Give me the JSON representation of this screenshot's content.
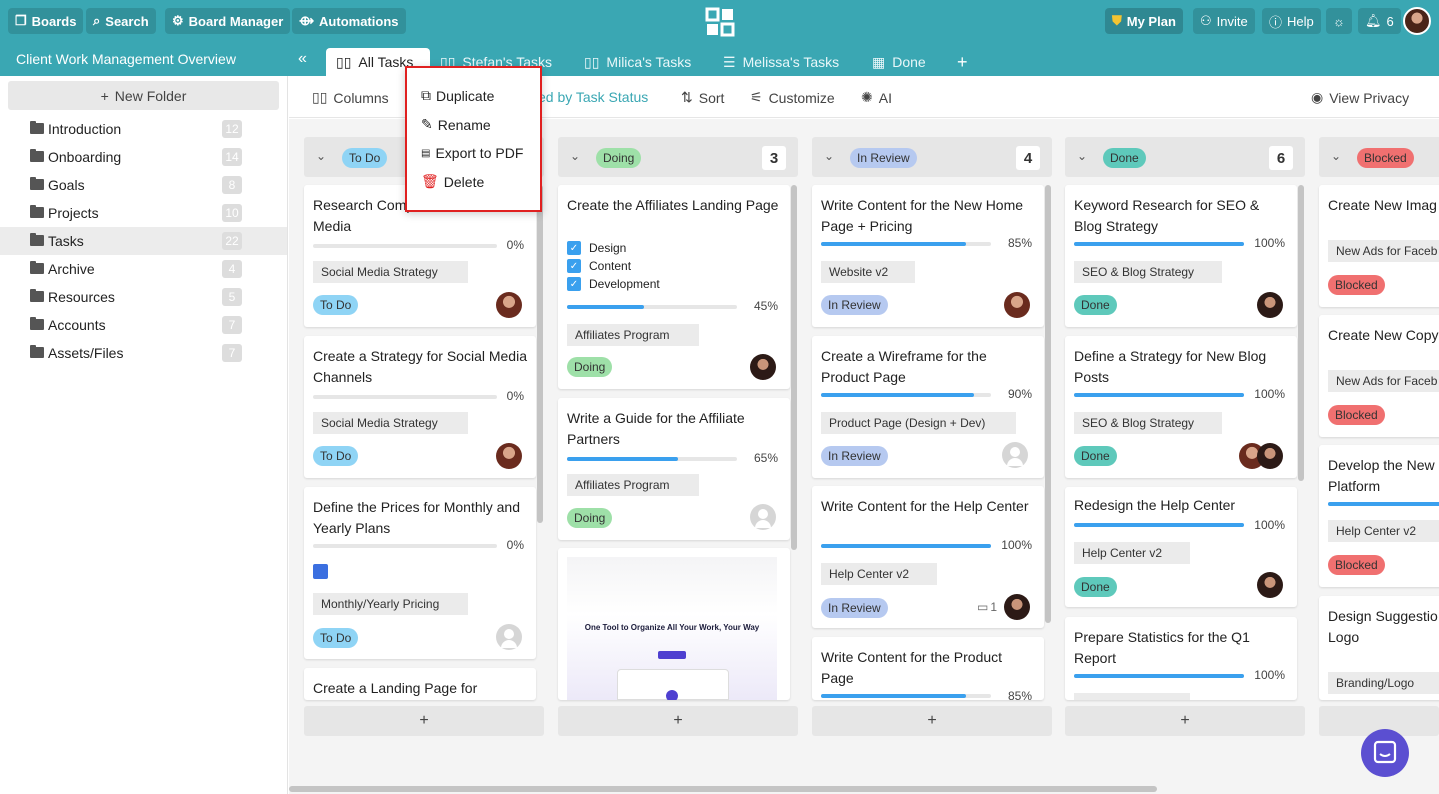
{
  "topbar": {
    "boards": "Boards",
    "search": "Search",
    "board_manager": "Board Manager",
    "automations": "Automations",
    "my_plan": "My Plan",
    "invite": "Invite",
    "help": "Help",
    "notifications": "6"
  },
  "board": {
    "title": "Client Work Management Overview",
    "tabs": [
      "All Tasks",
      "Stefan's Tasks",
      "Milica's Tasks",
      "Melissa's Tasks",
      "Done"
    ]
  },
  "sidebar": {
    "new_folder": "New Folder",
    "folders": [
      {
        "name": "Introduction",
        "count": "12"
      },
      {
        "name": "Onboarding",
        "count": "14"
      },
      {
        "name": "Goals",
        "count": "8"
      },
      {
        "name": "Projects",
        "count": "10"
      },
      {
        "name": "Tasks",
        "count": "22"
      },
      {
        "name": "Archive",
        "count": "4"
      },
      {
        "name": "Resources",
        "count": "5"
      },
      {
        "name": "Accounts",
        "count": "7"
      },
      {
        "name": "Assets/Files",
        "count": "7"
      }
    ]
  },
  "toolbar": {
    "columns": "Columns",
    "grouped": "ed by Task Status",
    "sort": "Sort",
    "customize": "Customize",
    "ai": "AI",
    "view_privacy": "View Privacy"
  },
  "context_menu": [
    "Duplicate",
    "Rename",
    "Export to PDF",
    "Delete"
  ],
  "colors": {
    "accent": "#3aa7b3",
    "todo": "#8fd4f5",
    "doing": "#9ee0a8",
    "review": "#b6c9f0",
    "done": "#5ec9bb",
    "blocked": "#f07070",
    "progress": "#3aa0ee"
  },
  "columns": [
    {
      "status": "To Do",
      "count": "",
      "cards": [
        {
          "title": "Research Competition a Social Media",
          "pct": "0%",
          "progress": 0,
          "tag": "Social Media Strategy",
          "status": "To Do"
        },
        {
          "title": "Create a Strategy for Social Media Channels",
          "pct": "0%",
          "progress": 0,
          "tag": "Social Media Strategy",
          "status": "To Do"
        },
        {
          "title": "Define the Prices for Monthly and Yearly Plans",
          "pct": "0%",
          "progress": 0,
          "tag": "Monthly/Yearly Pricing",
          "status": "To Do"
        },
        {
          "title": "Create a Landing Page for"
        }
      ]
    },
    {
      "status": "Doing",
      "count": "3",
      "cards": [
        {
          "title": "Create the Affiliates Landing Page",
          "checklist": [
            "Design",
            "Content",
            "Development"
          ],
          "pct": "45%",
          "progress": 45,
          "tag": "Affiliates Program",
          "status": "Doing"
        },
        {
          "title": "Write a Guide for the Affiliate Partners",
          "pct": "65%",
          "progress": 65,
          "tag": "Affiliates Program",
          "status": "Doing"
        },
        {
          "preview_heading": "One Tool to Organize All Your Work, Your Way"
        }
      ]
    },
    {
      "status": "In Review",
      "count": "4",
      "cards": [
        {
          "title": "Write Content for the New Home Page + Pricing",
          "pct": "85%",
          "progress": 85,
          "tag": "Website v2",
          "status": "In Review"
        },
        {
          "title": "Create a Wireframe for the Product Page",
          "pct": "90%",
          "progress": 90,
          "tag": "Product Page (Design + Dev)",
          "status": "In Review"
        },
        {
          "title": "Write Content for the Help Center",
          "pct": "100%",
          "progress": 100,
          "tag": "Help Center v2",
          "status": "In Review",
          "comments": "1"
        },
        {
          "title": "Write Content for the Product Page",
          "pct": "85%",
          "progress": 85
        }
      ]
    },
    {
      "status": "Done",
      "count": "6",
      "cards": [
        {
          "title": "Keyword Research for SEO & Blog Strategy",
          "pct": "100%",
          "progress": 100,
          "tag": "SEO & Blog Strategy",
          "status": "Done"
        },
        {
          "title": "Define a Strategy for New Blog Posts",
          "pct": "100%",
          "progress": 100,
          "tag": "SEO & Blog Strategy",
          "status": "Done"
        },
        {
          "title": "Redesign the Help Center",
          "pct": "100%",
          "progress": 100,
          "tag": "Help Center v2",
          "status": "Done"
        },
        {
          "title": "Prepare Statistics for the Q1 Report",
          "pct": "100%",
          "progress": 100
        }
      ]
    },
    {
      "status": "Blocked",
      "cards": [
        {
          "title": "Create New Imag",
          "tag": "New Ads for Faceb",
          "status": "Blocked"
        },
        {
          "title": "Create New Copy",
          "tag": "New Ads for Faceb",
          "status": "Blocked"
        },
        {
          "title": "Develop the New Platform",
          "tag": "Help Center v2",
          "status": "Blocked"
        },
        {
          "title": "Design Suggestio Logo",
          "tag": "Branding/Logo"
        }
      ]
    }
  ]
}
